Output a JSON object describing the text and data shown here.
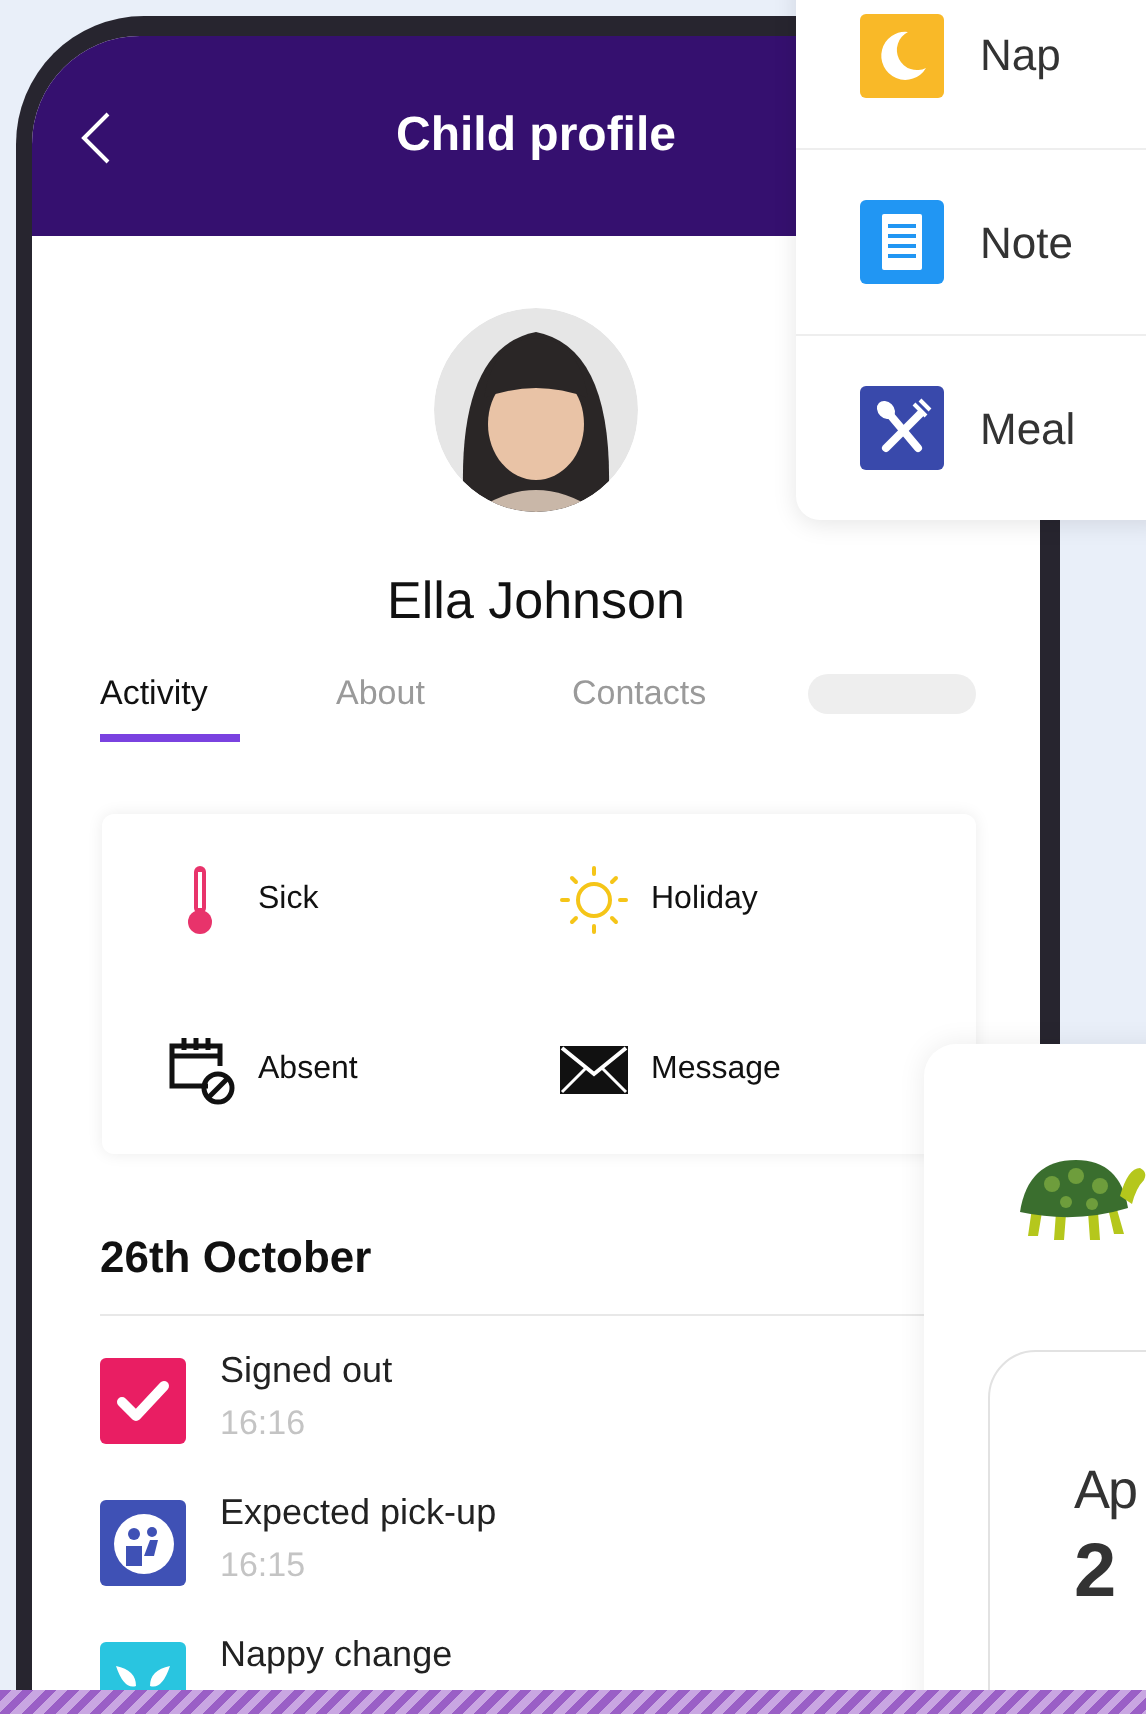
{
  "header": {
    "title": "Child profile"
  },
  "profile": {
    "name": "Ella Johnson"
  },
  "tabs": [
    {
      "kind": "text",
      "label": "Activity",
      "selected": true
    },
    {
      "kind": "text",
      "label": "About",
      "selected": false
    },
    {
      "kind": "text",
      "label": "Contacts",
      "selected": false
    },
    {
      "kind": "placeholder",
      "selected": false
    }
  ],
  "actions": [
    {
      "kind": "sick",
      "label": "Sick"
    },
    {
      "kind": "holiday",
      "label": "Holiday"
    },
    {
      "kind": "absent",
      "label": "Absent"
    },
    {
      "kind": "message",
      "label": "Message"
    }
  ],
  "timeline": {
    "date": "26th October",
    "events": [
      {
        "kind": "signed-out",
        "title": "Signed out",
        "time": "16:16"
      },
      {
        "kind": "pickup",
        "title": "Expected pick-up",
        "time": "16:15"
      },
      {
        "kind": "nappy",
        "title": "Nappy change"
      }
    ]
  },
  "quick_menu": [
    {
      "kind": "nap",
      "label": "Nap"
    },
    {
      "kind": "note",
      "label": "Note"
    },
    {
      "kind": "meal",
      "label": "Meal"
    }
  ],
  "side_card": {
    "inner": {
      "line_1": "Ap",
      "line_2": "2"
    }
  }
}
